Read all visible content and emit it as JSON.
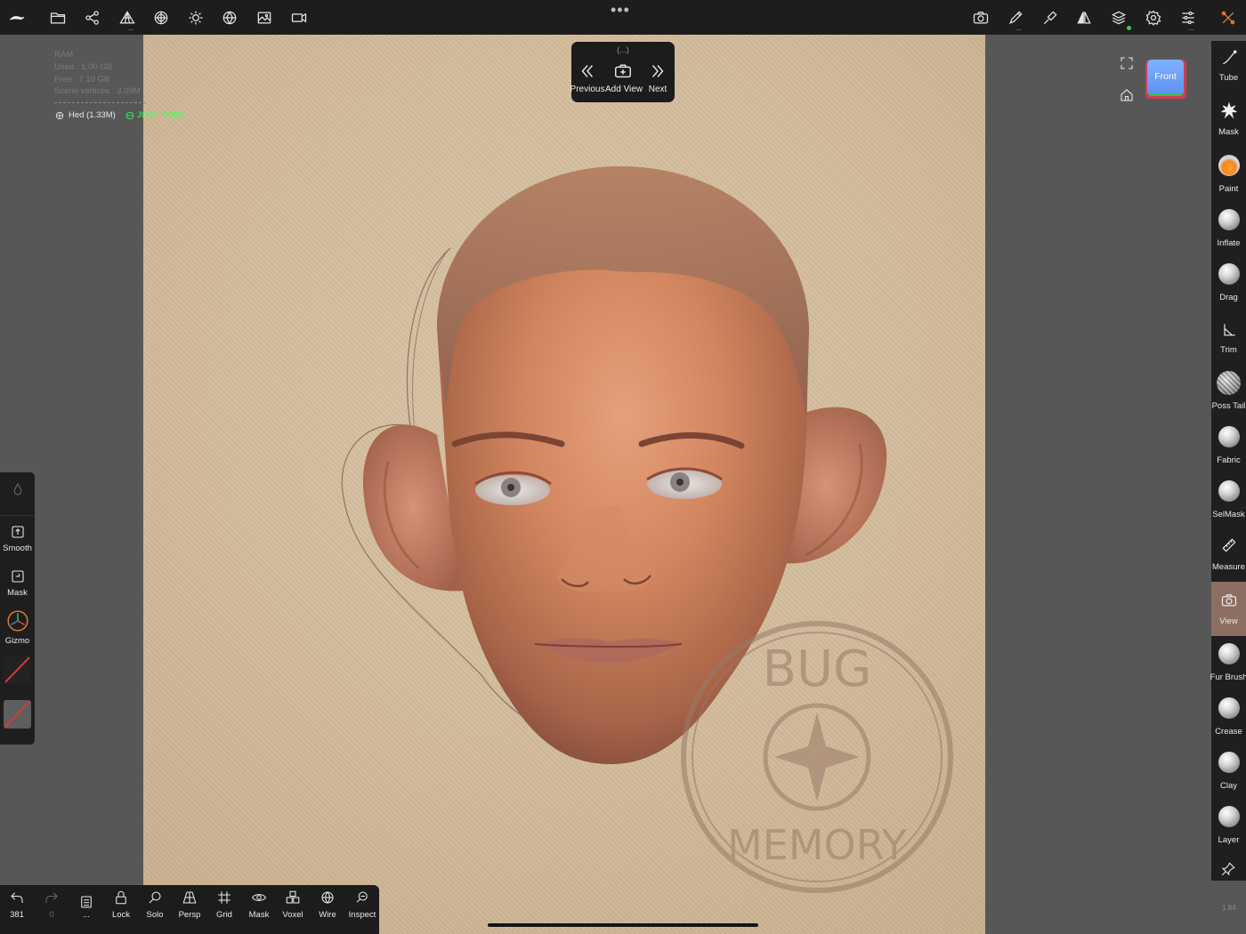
{
  "app": {
    "name": "Nomad Sculpt",
    "more_label": "•••"
  },
  "topbar": {
    "left_icons": [
      "nomad-logo-icon",
      "folder-icon",
      "scene-graph-icon",
      "topology-icon",
      "material-sphere-icon",
      "light-icon",
      "shading-icon",
      "background-image-icon",
      "video-camera-icon"
    ],
    "right_icons": [
      "screenshot-camera-icon",
      "stroke-pen-icon",
      "painting-icon",
      "symmetry-icon",
      "layers-icon",
      "settings-gear-icon",
      "sliders-icon",
      "tools-icon"
    ]
  },
  "hud": {
    "ram_title": "RAM",
    "used": "Used : 1.00 GB",
    "free": "Free : 7.10 GB",
    "scene_vertices": "Scene vertices : 3.09M",
    "mesh_name": "Hed (1.33M)",
    "just_paint": "JUST PAINT"
  },
  "views_popup": {
    "title": "(...)",
    "previous": "Previous",
    "add_view": "Add View",
    "next": "Next"
  },
  "view_cube": {
    "face": "Front"
  },
  "right_tools": [
    {
      "label": "Tube",
      "kind": "glyph",
      "icon": "tube-icon"
    },
    {
      "label": "Mask",
      "kind": "glyph",
      "icon": "mask-splat-icon"
    },
    {
      "label": "Paint",
      "kind": "sphere-orange"
    },
    {
      "label": "Inflate",
      "kind": "sphere"
    },
    {
      "label": "Drag",
      "kind": "sphere"
    },
    {
      "label": "Trim",
      "kind": "glyph",
      "icon": "trim-icon"
    },
    {
      "label": "Poss Tail",
      "kind": "sphere-pattern"
    },
    {
      "label": "Fabric",
      "kind": "sphere"
    },
    {
      "label": "SelMask",
      "kind": "sphere"
    },
    {
      "label": "Measure",
      "kind": "glyph",
      "icon": "ruler-icon"
    },
    {
      "label": "View",
      "kind": "glyph",
      "icon": "camera-icon",
      "active": true
    },
    {
      "label": "Fur Brush",
      "kind": "sphere"
    },
    {
      "label": "Crease",
      "kind": "sphere"
    },
    {
      "label": "Clay",
      "kind": "sphere"
    },
    {
      "label": "Layer",
      "kind": "sphere"
    }
  ],
  "version": "1.84",
  "left_panel": {
    "smooth": "Smooth",
    "mask": "Mask",
    "gizmo": "Gizmo"
  },
  "bottombar": {
    "undo": "381",
    "redo": "0",
    "more": "...",
    "lock": "Lock",
    "solo": "Solo",
    "persp": "Persp",
    "grid": "Grid",
    "mask": "Mask",
    "voxel": "Voxel",
    "wire": "Wire",
    "inspect": "Inspect"
  },
  "watermark": {
    "top_text": "BUG",
    "bottom_text": "MEMORY"
  },
  "colors": {
    "accent_active": "#8c6e63",
    "just_paint": "#3dff61",
    "canvas_bg": "#d2bb9b",
    "panel_bg": "#1f1f1f"
  }
}
